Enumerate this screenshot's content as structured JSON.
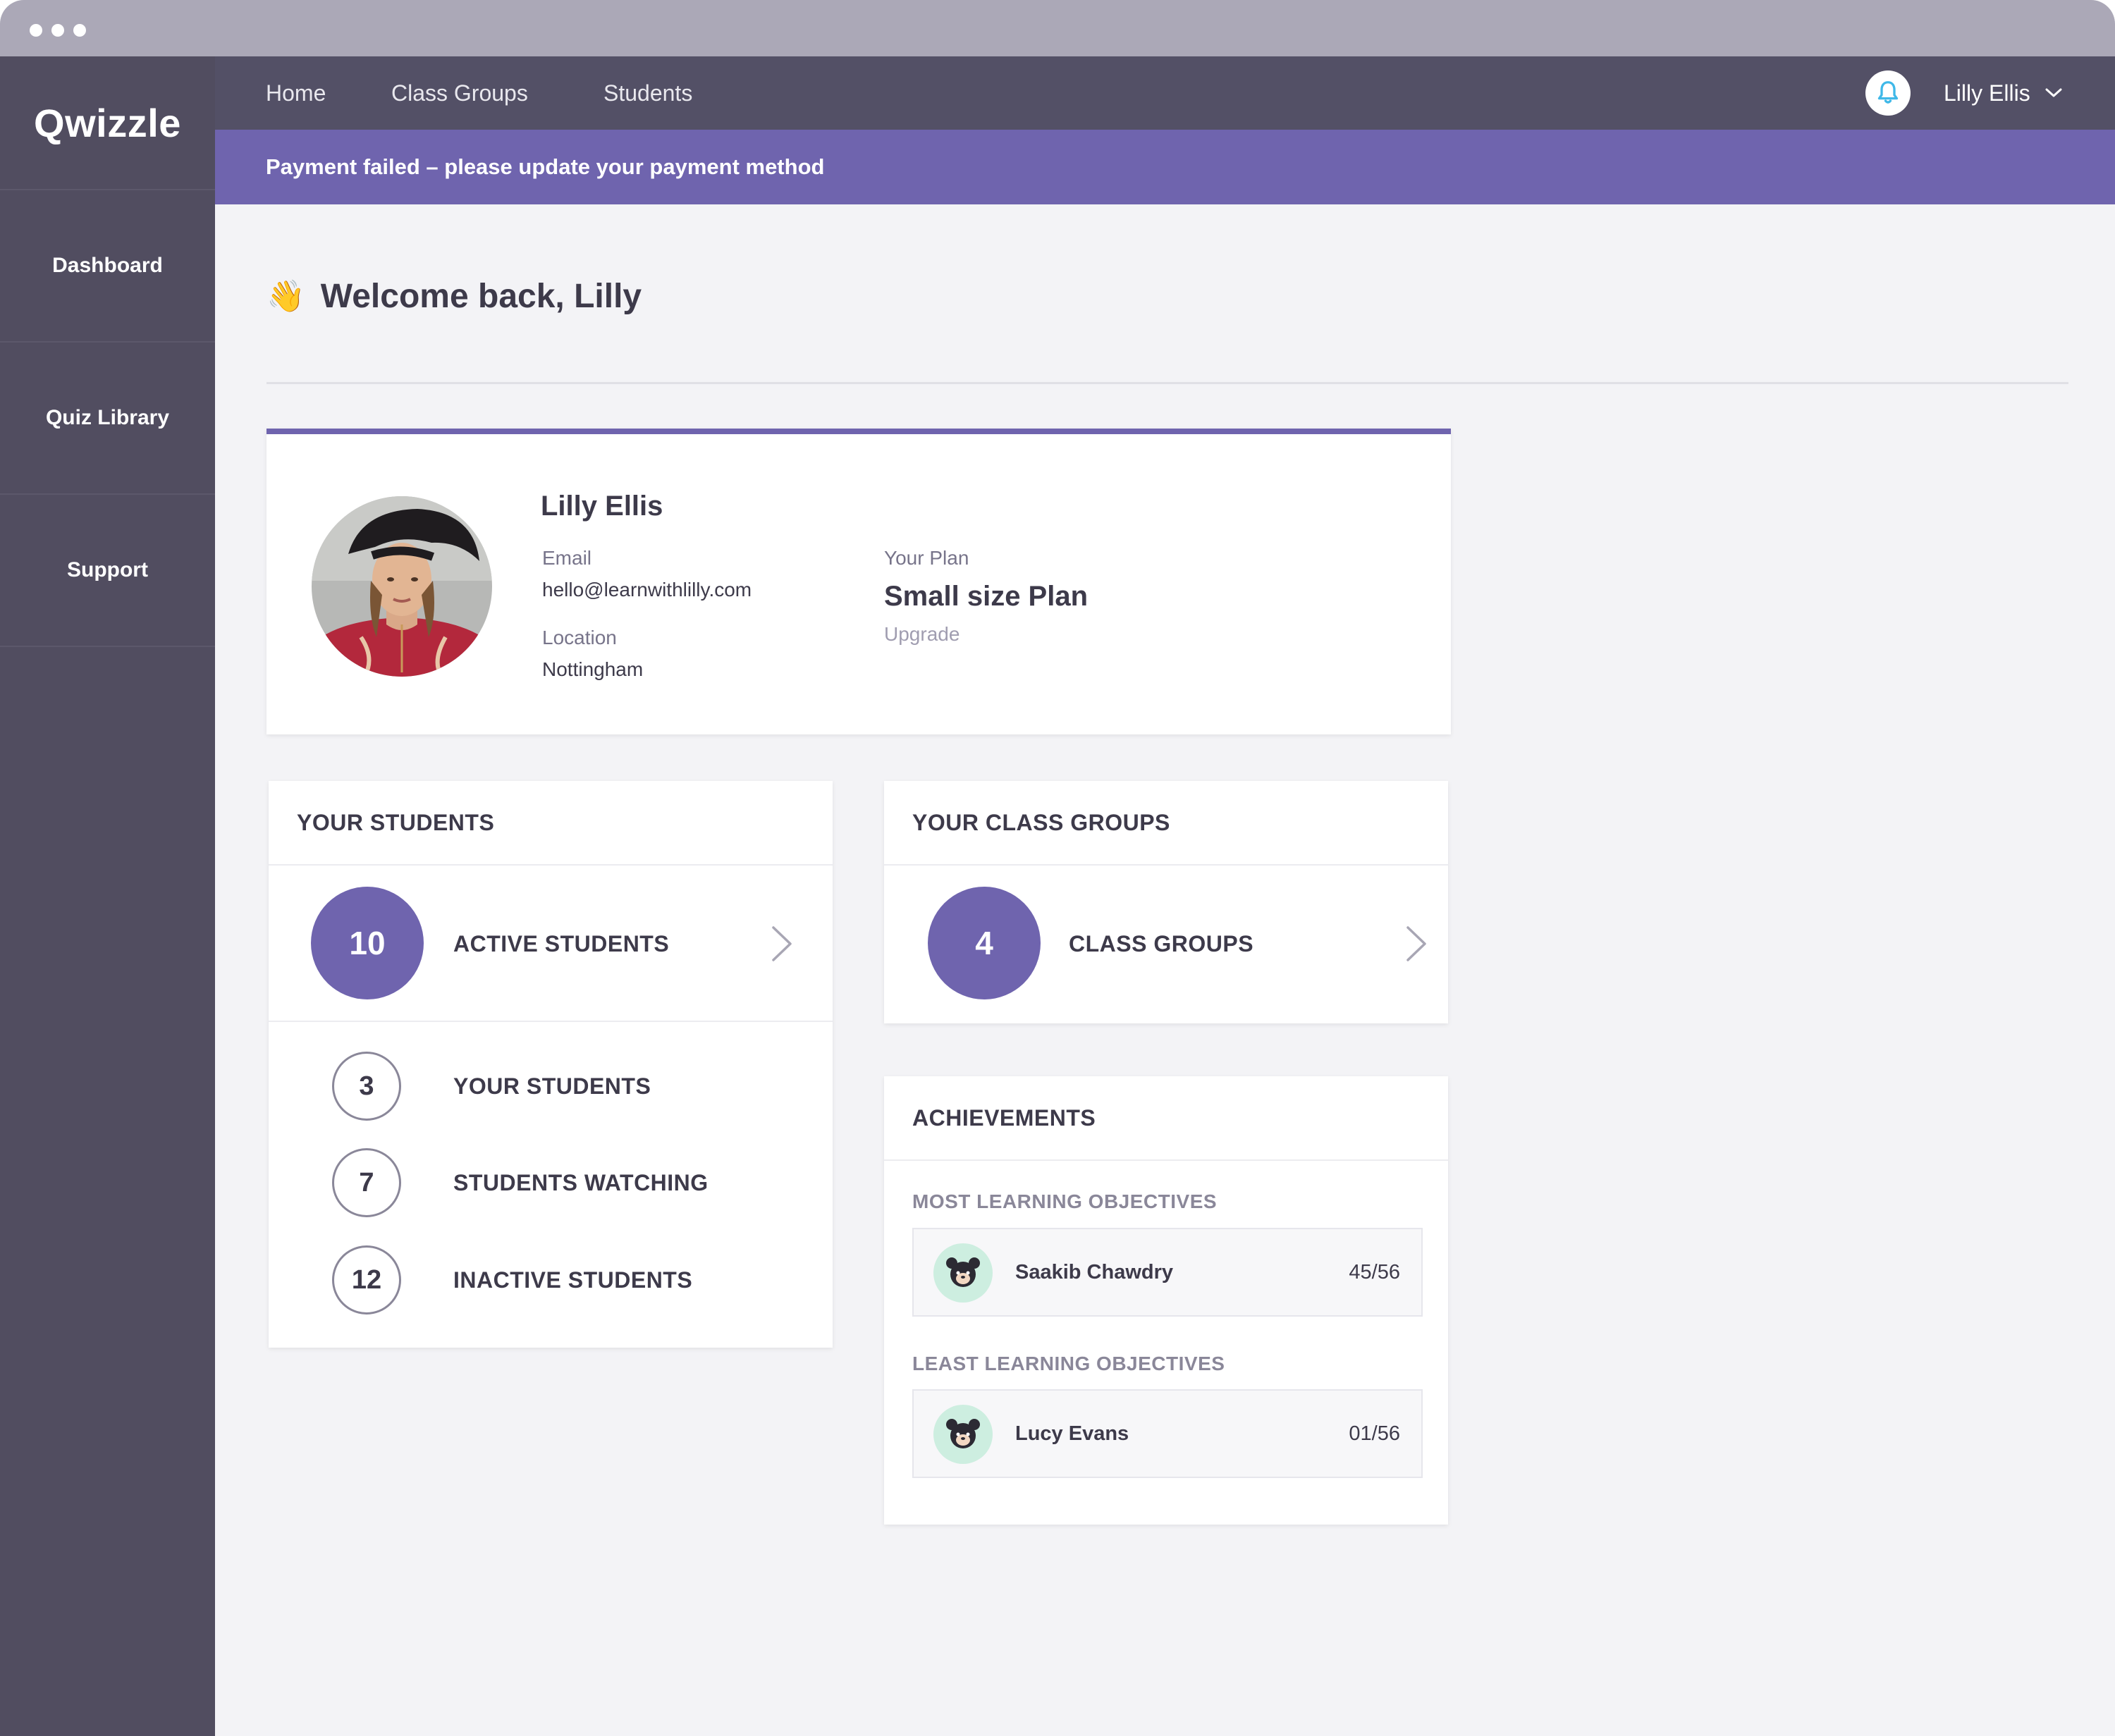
{
  "app": {
    "logo": "Qwizzle"
  },
  "sidebar": {
    "items": [
      {
        "label": "Dashboard"
      },
      {
        "label": "Quiz Library"
      },
      {
        "label": "Support"
      }
    ]
  },
  "topnav": {
    "links": [
      {
        "label": "Home"
      },
      {
        "label": "Class Groups"
      },
      {
        "label": "Students"
      }
    ],
    "user_name": "Lilly Ellis"
  },
  "banner": {
    "text": "Payment failed – please update your payment method"
  },
  "welcome": {
    "emoji": "👋",
    "text": "Welcome back, Lilly"
  },
  "profile": {
    "name": "Lilly Ellis",
    "email_label": "Email",
    "email": "hello@learnwithlilly.com",
    "location_label": "Location",
    "location": "Nottingham",
    "plan_label": "Your Plan",
    "plan": "Small size Plan",
    "upgrade": "Upgrade"
  },
  "students_card": {
    "title": "YOUR STUDENTS",
    "active": {
      "count": "10",
      "label": "ACTIVE STUDENTS"
    },
    "rows": [
      {
        "count": "3",
        "label": "YOUR STUDENTS"
      },
      {
        "count": "7",
        "label": "STUDENTS WATCHING"
      },
      {
        "count": "12",
        "label": "INACTIVE STUDENTS"
      }
    ]
  },
  "class_groups_card": {
    "title": "YOUR CLASS GROUPS",
    "count": "4",
    "label": "CLASS GROUPS"
  },
  "achievements": {
    "title": "ACHIEVEMENTS",
    "most": {
      "heading": "MOST LEARNING OBJECTIVES",
      "name": "Saakib Chawdry",
      "score": "45/56"
    },
    "least": {
      "heading": "LEAST LEARNING OBJECTIVES",
      "name": "Lucy Evans",
      "score": "01/56"
    }
  },
  "colors": {
    "accent": "#6f64ae",
    "sidebar": "#514d60",
    "topnav": "#535066",
    "bell_icon": "#3fb8e8",
    "avatar_bg": "#cdeee0"
  },
  "icons": {
    "bell": "bell-icon",
    "user_menu": "chevron-down-icon",
    "row_arrow": "chevron-right-icon",
    "student_avatar": "bear-avatar-icon"
  }
}
